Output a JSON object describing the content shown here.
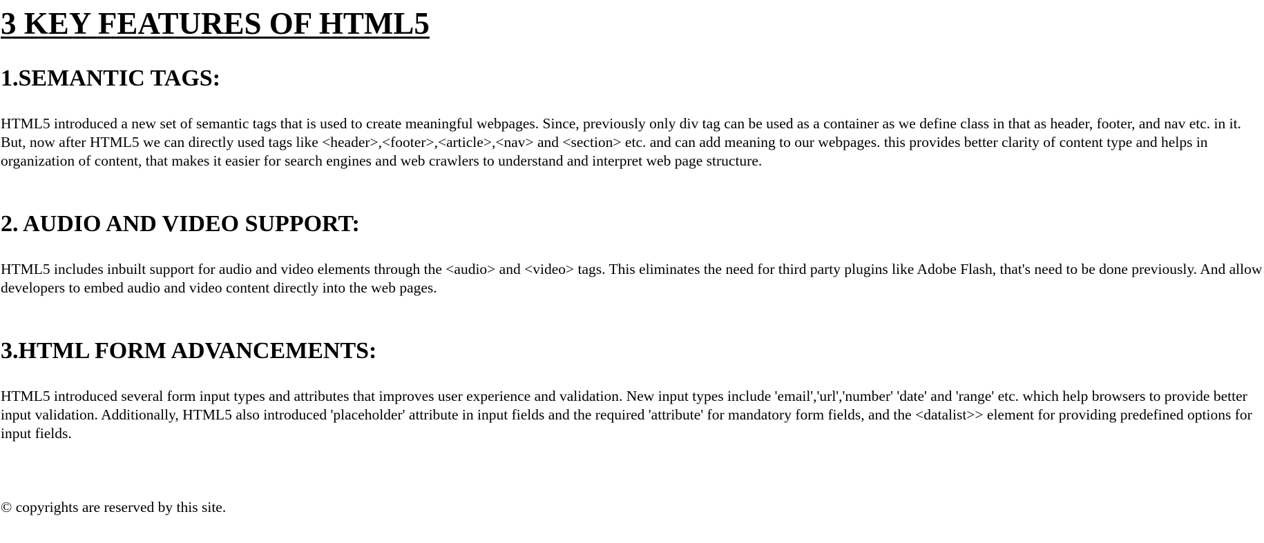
{
  "title": "3 KEY FEATURES OF HTML5",
  "sections": [
    {
      "heading": "1.SEMANTIC TAGS:",
      "body": "HTML5 introduced a new set of semantic tags that is used to create meaningful webpages. Since, previously only div tag can be used as a container as we define class in that as header, footer, and nav etc. in it. But, now after HTML5 we can directly used tags like <header>,<footer>,<article>,<nav> and <section> etc. and can add meaning to our webpages. this provides better clarity of content type and helps in organization of content, that makes it easier for search engines and web crawlers to understand and interpret web page structure."
    },
    {
      "heading": "2. AUDIO AND VIDEO SUPPORT:",
      "body": "HTML5 includes inbuilt support for audio and video elements through the <audio> and <video> tags. This eliminates the need for third party plugins like Adobe Flash, that's need to be done previously. And allow developers to embed audio and video content directly into the web pages."
    },
    {
      "heading": "3.HTML FORM ADVANCEMENTS:",
      "body": "HTML5 introduced several form input types and attributes that improves user experience and validation. New input types include 'email','url','number' 'date' and 'range' etc. which help browsers to provide better input validation. Additionally, HTML5 also introduced 'placeholder' attribute in input fields and the required 'attribute' for mandatory form fields, and the <datalist>> element for providing predefined options for input fields."
    }
  ],
  "footer": {
    "text": "© copyrights are reserved by this site."
  }
}
